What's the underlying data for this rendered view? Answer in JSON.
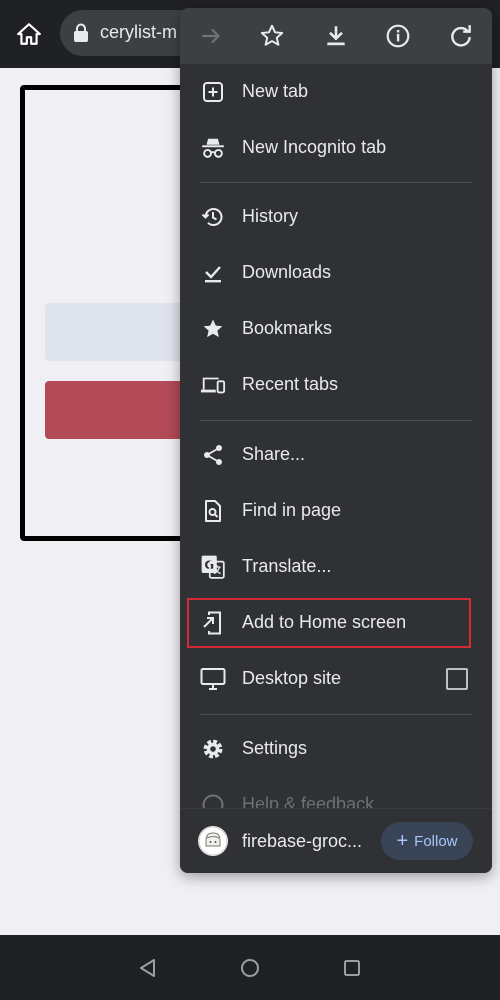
{
  "browser": {
    "url_text": "cerylist-m"
  },
  "menu": {
    "items": [
      {
        "label": "New tab",
        "icon": "new-tab-icon"
      },
      {
        "label": "New Incognito tab",
        "icon": "incognito-icon"
      },
      {
        "label": "History",
        "icon": "history-icon"
      },
      {
        "label": "Downloads",
        "icon": "downloads-done-icon"
      },
      {
        "label": "Bookmarks",
        "icon": "star-filled-icon"
      },
      {
        "label": "Recent tabs",
        "icon": "devices-icon"
      },
      {
        "label": "Share...",
        "icon": "share-icon"
      },
      {
        "label": "Find in page",
        "icon": "find-in-page-icon"
      },
      {
        "label": "Translate...",
        "icon": "translate-icon"
      },
      {
        "label": "Add to Home screen",
        "icon": "add-to-home-icon"
      },
      {
        "label": "Desktop site",
        "icon": "desktop-icon"
      },
      {
        "label": "Settings",
        "icon": "settings-icon"
      },
      {
        "label": "Help & feedback",
        "icon": "help-icon"
      }
    ],
    "desktop_site_checked": false,
    "highlighted_item": "Add to Home screen"
  },
  "footer": {
    "site_name": "firebase-groc...",
    "follow_label": "Follow"
  },
  "colors": {
    "highlight_border": "#d12c35",
    "card_button": "#b34a58",
    "follow_text": "#a8c7fa"
  }
}
